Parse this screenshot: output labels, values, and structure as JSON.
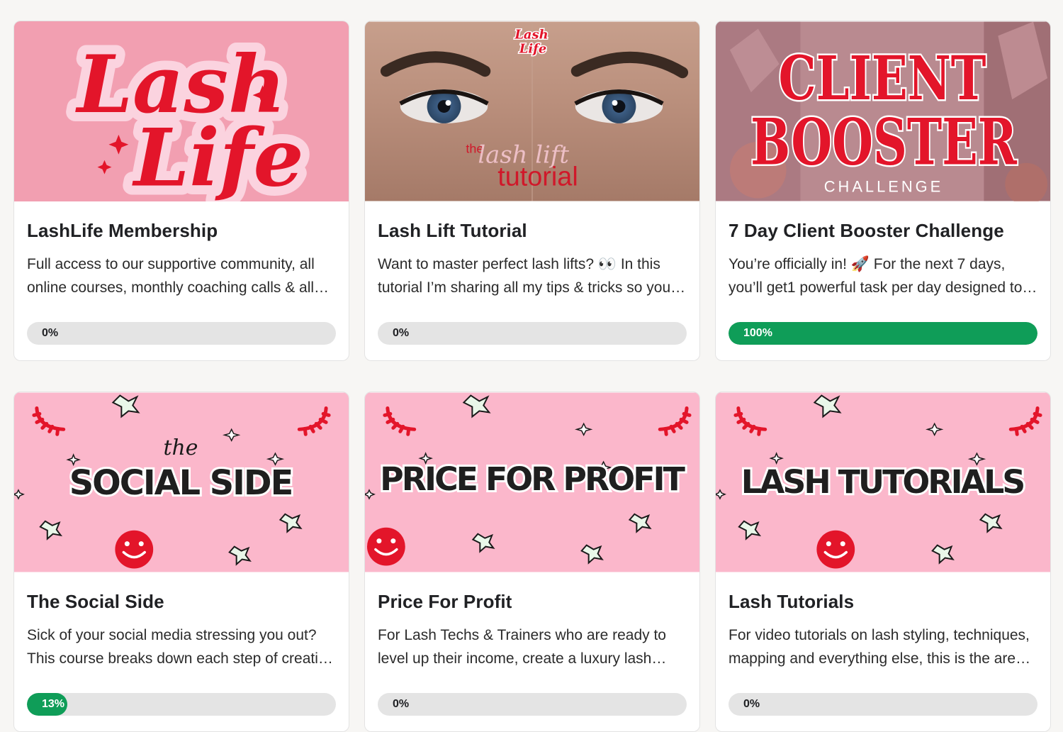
{
  "courses": [
    {
      "title": "LashLife Membership",
      "description": "Full access to our supportive community, all online courses, monthly coaching calls & all the resources you need to grow.",
      "progress_label": "0%",
      "progress": 0,
      "thumb_text": [
        "Lash",
        "Life"
      ]
    },
    {
      "title": "Lash Lift Tutorial",
      "description": "Want to master perfect lash lifts? 👀 In this tutorial I’m sharing all my tips & tricks so you can create flawless results.",
      "progress_label": "0%",
      "progress": 0,
      "thumb_text": [
        "Lash",
        "Life",
        "the",
        "lash lift",
        "tutorial"
      ]
    },
    {
      "title": "7 Day Client Booster Challenge",
      "description": "You’re officially in! 🚀 For the next 7 days, you’ll get1 powerful task per day designed to help you book more clients.",
      "progress_label": "100%",
      "progress": 1.0,
      "thumb_text": [
        "CLIENT",
        "BOOSTER",
        "CHALLENGE"
      ]
    },
    {
      "title": "The Social Side",
      "description": "Sick of your social media stressing you out? This course breaks down each step of creating content.",
      "progress_label": "13%",
      "progress": 0.13,
      "thumb_text": [
        "the",
        "SOCIAL SIDE"
      ]
    },
    {
      "title": "Price For Profit",
      "description": "For Lash Techs & Trainers who are ready to level up their income, create a luxury lash business.",
      "progress_label": "0%",
      "progress": 0,
      "thumb_text": [
        "PRICE FOR PROFIT"
      ]
    },
    {
      "title": "Lash Tutorials",
      "description": "For video tutorials on lash styling, techniques, mapping and everything else, this is the area for you.",
      "progress_label": "0%",
      "progress": 0,
      "thumb_text": [
        "LASH TUTORIALS"
      ]
    }
  ],
  "colors": {
    "brand_red": "#e3152a",
    "brand_pink": "#f4a6b5",
    "light_pink": "#f9c9d6",
    "progress_green": "#0f9d58",
    "progress_track": "#e4e4e4"
  }
}
